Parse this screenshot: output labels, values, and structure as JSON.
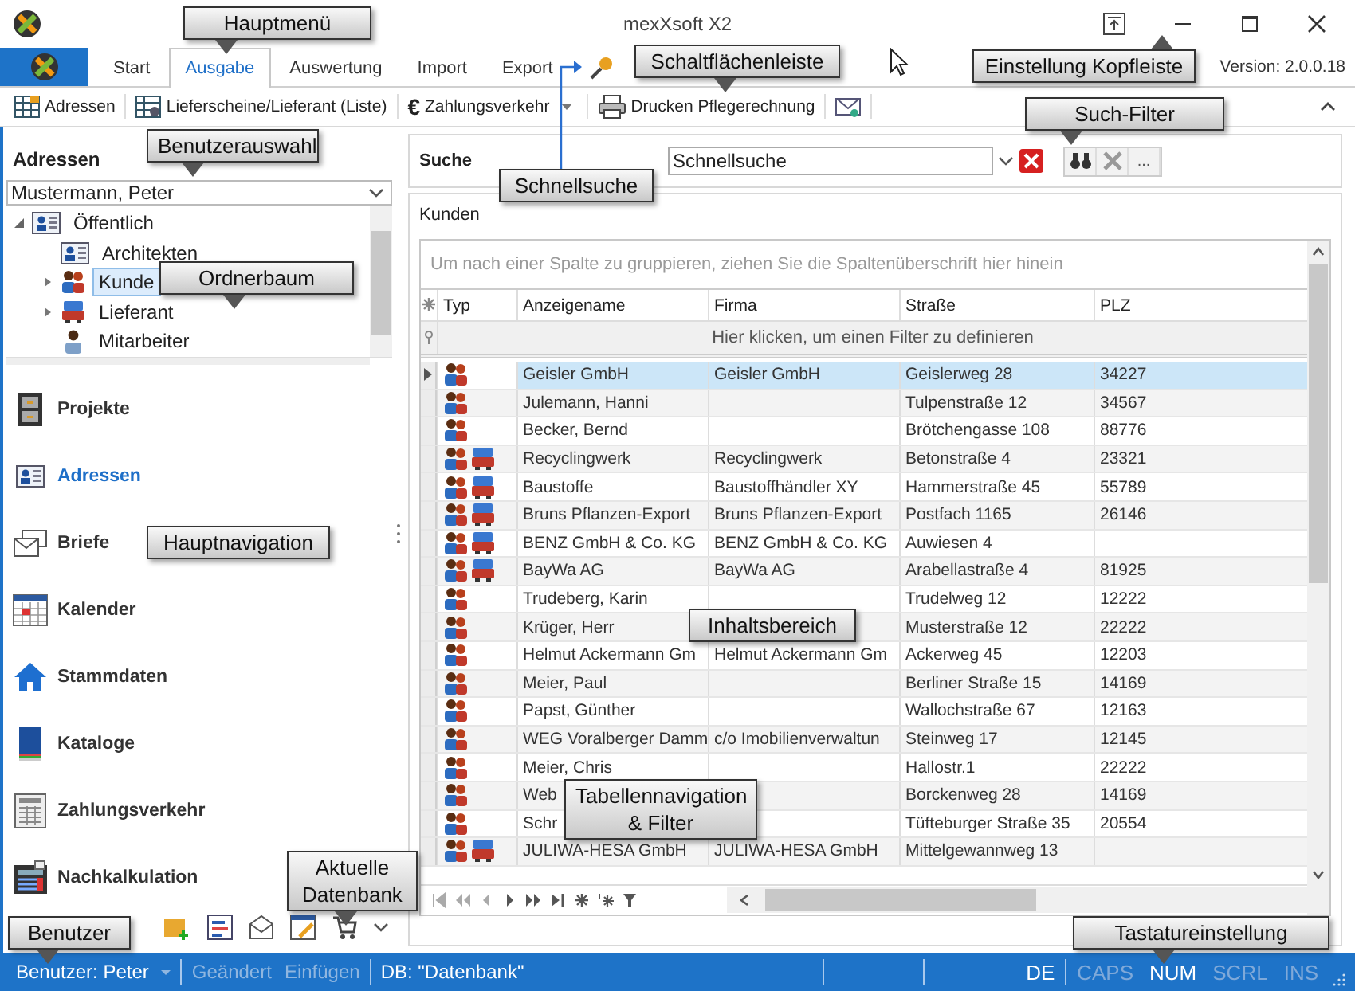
{
  "window": {
    "title": "mexXsoft X2"
  },
  "ribbon": {
    "tabs": [
      {
        "label": "Start",
        "selected": false
      },
      {
        "label": "Ausgabe",
        "selected": true
      },
      {
        "label": "Auswertung",
        "selected": false
      },
      {
        "label": "Import",
        "selected": false
      },
      {
        "label": "Export",
        "selected": false
      }
    ],
    "version": "Version: 2.0.0.18"
  },
  "toolbar": [
    {
      "label": "Adressen",
      "kind": "grid"
    },
    {
      "label": "Lieferscheine/Lieferant (Liste)",
      "kind": "list"
    },
    {
      "label": "Zahlungsverkehr",
      "kind": "symbol",
      "symbol": "€",
      "dropdown": true
    },
    {
      "label": "Drucken Pflegerechnung",
      "kind": "print"
    },
    {
      "kind": "mail"
    }
  ],
  "sidebar": {
    "title": "Adressen",
    "user_select": "Mustermann, Peter",
    "tree": [
      {
        "label": "Öffentlich",
        "kind": "card",
        "expanded": true,
        "selected": false,
        "children": [
          {
            "label": "Architekten",
            "kind": "card",
            "selected": false
          },
          {
            "label": "Kunde",
            "kind": "people",
            "expanded": false,
            "selected": true
          },
          {
            "label": "Lieferant",
            "kind": "truck",
            "expanded": false,
            "selected": false
          },
          {
            "label": "Mitarbeiter",
            "kind": "person",
            "selected": false
          }
        ]
      }
    ],
    "nav": [
      {
        "label": "Projekte",
        "kind": "cabinet",
        "selected": false
      },
      {
        "label": "Adressen",
        "kind": "card",
        "selected": true
      },
      {
        "label": "Briefe",
        "kind": "envelope",
        "selected": false
      },
      {
        "label": "Kalender",
        "kind": "calendar",
        "selected": false
      },
      {
        "label": "Stammdaten",
        "kind": "home",
        "selected": false
      },
      {
        "label": "Kataloge",
        "kind": "book",
        "selected": false
      },
      {
        "label": "Zahlungsverkehr",
        "kind": "ledger",
        "selected": false
      },
      {
        "label": "Nachkalkulation",
        "kind": "calculator",
        "selected": false
      }
    ]
  },
  "search": {
    "label": "Suche",
    "value": "Schnellsuche",
    "more": "..."
  },
  "content": {
    "title": "Kunden",
    "group_hint": "Um nach einer Spalte zu gruppieren, ziehen Sie die Spaltenüberschrift hier hinein",
    "columns": [
      "Typ",
      "Anzeigename",
      "Firma",
      "Straße",
      "PLZ"
    ],
    "filter_hint": "Hier klicken, um einen Filter zu definieren",
    "rows": [
      {
        "kind": "customer",
        "cells": [
          "",
          "Geisler GmbH",
          "Geisler GmbH",
          "Geislerweg 28",
          "34227"
        ],
        "selected": true
      },
      {
        "kind": "customer",
        "cells": [
          "",
          "Julemann, Hanni",
          "",
          "Tulpenstraße 12",
          "34567"
        ],
        "selected": false
      },
      {
        "kind": "customer",
        "cells": [
          "",
          "Becker, Bernd",
          "",
          "Brötchengasse 108",
          "88776"
        ],
        "selected": false
      },
      {
        "kind": "both",
        "cells": [
          "",
          "Recyclingwerk",
          "Recyclingwerk",
          "Betonstraße 4",
          "23321"
        ],
        "selected": false
      },
      {
        "kind": "both",
        "cells": [
          "",
          "Baustoffe",
          "Baustoffhändler XY",
          "Hammerstraße 45",
          "55789"
        ],
        "selected": false
      },
      {
        "kind": "both",
        "cells": [
          "",
          "Bruns Pflanzen-Export",
          "Bruns Pflanzen-Export",
          "Postfach 1165",
          "26146"
        ],
        "selected": false
      },
      {
        "kind": "both",
        "cells": [
          "",
          "BENZ GmbH & Co. KG",
          "BENZ GmbH & Co. KG",
          "Auwiesen 4",
          ""
        ],
        "selected": false
      },
      {
        "kind": "both",
        "cells": [
          "",
          "BayWa AG",
          "BayWa AG",
          "Arabellastraße 4",
          "81925"
        ],
        "selected": false
      },
      {
        "kind": "customer",
        "cells": [
          "",
          "Trudeberg, Karin",
          "",
          "Trudelweg 12",
          "12222"
        ],
        "selected": false
      },
      {
        "kind": "customer",
        "cells": [
          "",
          "Krüger, Herr",
          "",
          "Musterstraße 12",
          "22222"
        ],
        "selected": false
      },
      {
        "kind": "customer",
        "cells": [
          "",
          "Helmut Ackermann Gm",
          "Helmut Ackermann Gm",
          "Ackerweg 45",
          "12203"
        ],
        "selected": false
      },
      {
        "kind": "customer",
        "cells": [
          "",
          "Meier, Paul",
          "",
          "Berliner Straße 15",
          "14169"
        ],
        "selected": false
      },
      {
        "kind": "customer",
        "cells": [
          "",
          "Papst, Günther",
          "",
          "Wallochstraße 67",
          "12163"
        ],
        "selected": false
      },
      {
        "kind": "customer",
        "cells": [
          "",
          "WEG Voralberger Damm",
          "c/o Imobilienverwaltun",
          "Steinweg 17",
          "12145"
        ],
        "selected": false
      },
      {
        "kind": "customer",
        "cells": [
          "",
          "Meier, Chris",
          "",
          "Hallostr.1",
          "22222"
        ],
        "selected": false
      },
      {
        "kind": "customer",
        "cells": [
          "",
          "Web",
          "",
          "Borckenweg 28",
          "14169"
        ],
        "selected": false
      },
      {
        "kind": "customer",
        "cells": [
          "",
          "Schr",
          "",
          "Tüfteburger Straße 35",
          "20554"
        ],
        "selected": false
      },
      {
        "kind": "both",
        "cells": [
          "",
          "JULIWA-HESA GmbH",
          "JULIWA-HESA GmbH",
          "Mittelgewannweg 13",
          ""
        ],
        "selected": false
      }
    ]
  },
  "status_bar": {
    "user": "Benutzer: Peter",
    "actions": [
      {
        "label": "Geändert",
        "disabled": true
      },
      {
        "label": "Einfügen",
        "disabled": true
      }
    ],
    "database": "DB: \"Datenbank\"",
    "language": "DE",
    "keys": [
      {
        "label": "CAPS",
        "on": false
      },
      {
        "label": "NUM",
        "on": true
      },
      {
        "label": "SCRL",
        "on": false
      },
      {
        "label": "INS",
        "on": false
      }
    ]
  },
  "callouts": [
    {
      "text": "Hauptmenü"
    },
    {
      "text": "Schaltflächenleiste"
    },
    {
      "text": "Einstellung Kopfleiste"
    },
    {
      "text": "Such-Filter"
    },
    {
      "text": "Benutzerauswahl"
    },
    {
      "text": "Schnellsuche"
    },
    {
      "text": "Ordnerbaum"
    },
    {
      "text": "Hauptnavigation"
    },
    {
      "text": "Inhaltsbereich"
    },
    {
      "text": "Tabellennavigation & Filter"
    },
    {
      "text": "Aktuelle Datenbank"
    },
    {
      "text": "Benutzer"
    },
    {
      "text": "Tastatureinstellung"
    }
  ]
}
